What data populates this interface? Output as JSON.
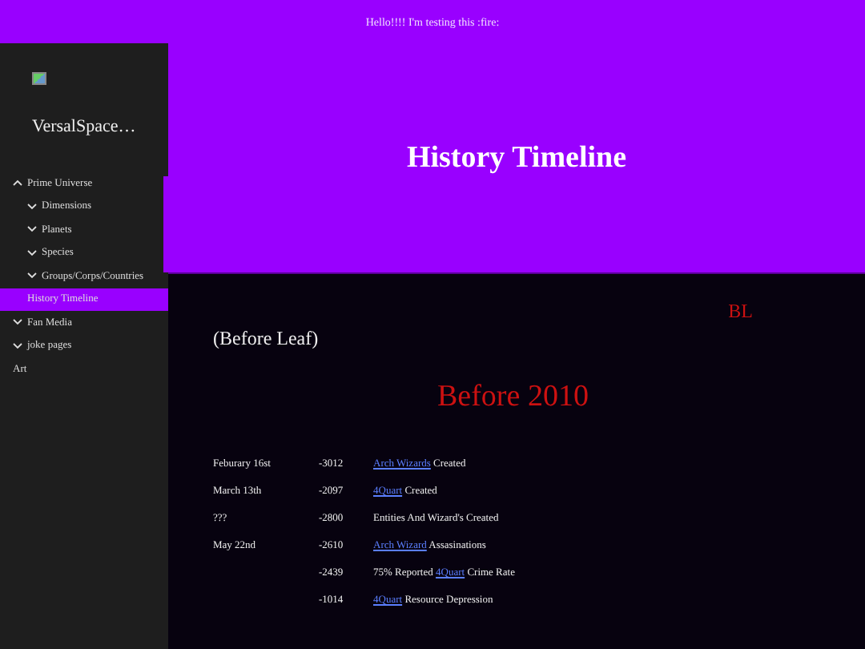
{
  "banner": {
    "text": "Hello!!!! I'm testing this :fire:"
  },
  "sidebar": {
    "site_name": "VersalSpace…",
    "items": [
      {
        "label": "Prime Universe",
        "expanded": true,
        "selected": false,
        "children": [
          {
            "label": "Dimensions",
            "expanded": false,
            "selected": false
          },
          {
            "label": "Planets",
            "expanded": false,
            "selected": false
          },
          {
            "label": "Species",
            "expanded": false,
            "selected": false
          },
          {
            "label": "Groups/Corps/Countries",
            "expanded": false,
            "selected": false
          },
          {
            "label": "History Timeline",
            "selected": true
          }
        ]
      },
      {
        "label": "Fan Media",
        "expanded": false,
        "selected": false
      },
      {
        "label": "joke pages",
        "expanded": false,
        "selected": false
      },
      {
        "label": "Art",
        "selected": false
      }
    ]
  },
  "header": {
    "title": "History Timeline"
  },
  "content": {
    "era_code": "BL",
    "era_name": "(Before Leaf)",
    "section_title": "Before 2010",
    "rows": [
      {
        "date": "Feburary 16st",
        "year": "-3012",
        "event": [
          {
            "text": "Arch Wizards",
            "kind": "link"
          },
          {
            "text": " Created",
            "kind": "text"
          }
        ]
      },
      {
        "date": "March 13th",
        "year": "-2097",
        "event": [
          {
            "text": "4Quart",
            "kind": "link"
          },
          {
            "text": " Created",
            "kind": "text"
          }
        ]
      },
      {
        "date": "???",
        "year": "-2800",
        "event": [
          {
            "text": "Entities And Wizard's Created",
            "kind": "text"
          }
        ]
      },
      {
        "date": "May 22nd",
        "year": "-2610",
        "event": [
          {
            "text": "Arch Wizard",
            "kind": "link"
          },
          {
            "text": " Assasinations",
            "kind": "text"
          }
        ]
      },
      {
        "year": "-2439",
        "event": [
          {
            "text": "75% Reported ",
            "kind": "text"
          },
          {
            "text": "4Quart",
            "kind": "link"
          },
          {
            "text": " Crime Rate",
            "kind": "text"
          }
        ]
      },
      {
        "year": "-1014",
        "event": [
          {
            "text": "4Quart",
            "kind": "link"
          },
          {
            "text": " Resource Depression",
            "kind": "text"
          }
        ]
      }
    ]
  }
}
